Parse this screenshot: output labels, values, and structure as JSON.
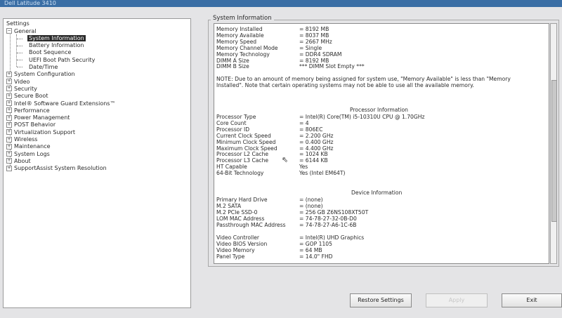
{
  "window": {
    "title": "Dell Latitude 3410"
  },
  "tree": {
    "root": "Settings",
    "general": "General",
    "general_children": [
      "System Information",
      "Battery Information",
      "Boot Sequence",
      "UEFI Boot Path Security",
      "Date/Time"
    ],
    "categories": [
      "System Configuration",
      "Video",
      "Security",
      "Secure Boot",
      "Intel® Software Guard Extensions™",
      "Performance",
      "Power Management",
      "POST Behavior",
      "Virtualization Support",
      "Wireless",
      "Maintenance",
      "System Logs",
      "About",
      "SupportAssist System Resolution"
    ]
  },
  "panel": {
    "title": "System Information"
  },
  "memory": [
    {
      "k": "Memory Installed",
      "v": "= 8192 MB"
    },
    {
      "k": "Memory Available",
      "v": "= 8037 MB"
    },
    {
      "k": "Memory Speed",
      "v": "= 2667 MHz"
    },
    {
      "k": "Memory Channel Mode",
      "v": "= Single"
    },
    {
      "k": "Memory Technology",
      "v": "= DDR4 SDRAM"
    },
    {
      "k": "DIMM A Size",
      "v": "= 8192 MB"
    },
    {
      "k": "DIMM B Size",
      "v": "*** DIMM Slot Empty ***"
    }
  ],
  "note": "NOTE: Due to an amount of memory being assigned for system use, \"Memory Available\" is less than \"Memory Installed\". Note that certain operating systems may not be able to use all the available memory.",
  "processor": {
    "title": "Processor Information",
    "rows": [
      {
        "k": "Processor Type",
        "v": "= Intel(R) Core(TM) i5-10310U CPU @ 1.70GHz"
      },
      {
        "k": "Core Count",
        "v": "= 4"
      },
      {
        "k": "Processor ID",
        "v": "= 806EC"
      },
      {
        "k": "Current Clock Speed",
        "v": "= 2.200 GHz"
      },
      {
        "k": "Minimum Clock Speed",
        "v": "= 0.400 GHz"
      },
      {
        "k": "Maximum Clock Speed",
        "v": "= 4.400 GHz"
      },
      {
        "k": "Processor L2 Cache",
        "v": "= 1024 KB"
      },
      {
        "k": "Processor L3 Cache",
        "v": "= 6144 KB"
      },
      {
        "k": "HT Capable",
        "v": "Yes"
      },
      {
        "k": "64-Bit Technology",
        "v": "Yes (Intel EM64T)"
      }
    ]
  },
  "device": {
    "title": "Device Information",
    "rows": [
      {
        "k": "Primary Hard Drive",
        "v": "= (none)"
      },
      {
        "k": "M.2 SATA",
        "v": "= (none)"
      },
      {
        "k": "M.2 PCIe SSD-0",
        "v": "= 256 GB Z6NS108XT50T"
      },
      {
        "k": "LOM MAC Address",
        "v": "= 74-78-27-32-0B-D0"
      },
      {
        "k": "Passthrough MAC Address",
        "v": "= 74-78-27-A6-1C-6B"
      }
    ],
    "rows2": [
      {
        "k": "Video Controller",
        "v": "= Intel(R) UHD Graphics"
      },
      {
        "k": "Video BIOS Version",
        "v": "= GOP 1105"
      },
      {
        "k": "Video Memory",
        "v": "= 64 MB"
      },
      {
        "k": "Panel Type",
        "v": "= 14.0\" FHD"
      }
    ]
  },
  "buttons": {
    "restore": "Restore Settings",
    "apply": "Apply",
    "exit": "Exit"
  }
}
